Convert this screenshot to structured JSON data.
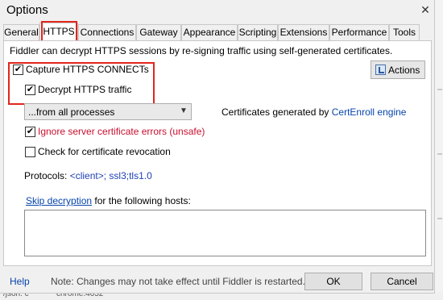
{
  "window": {
    "title": "Options"
  },
  "tabs": [
    {
      "label": "General"
    },
    {
      "label": "HTTPS"
    },
    {
      "label": "Connections"
    },
    {
      "label": "Gateway"
    },
    {
      "label": "Appearance"
    },
    {
      "label": "Scripting"
    },
    {
      "label": "Extensions"
    },
    {
      "label": "Performance"
    },
    {
      "label": "Tools"
    }
  ],
  "active_tab": "HTTPS",
  "https": {
    "intro": "Fiddler can decrypt HTTPS sessions by re-signing traffic using self-generated certificates.",
    "capture": {
      "label": "Capture HTTPS CONNECTs",
      "checked": true
    },
    "decrypt": {
      "label": "Decrypt HTTPS traffic",
      "checked": true
    },
    "process_filter": {
      "selected": "...from all processes"
    },
    "cert_prefix": "Certificates generated by",
    "cert_engine": "CertEnroll engine",
    "ignore_errors": {
      "label": "Ignore server certificate errors (unsafe)",
      "checked": true
    },
    "revocation": {
      "label": "Check for certificate revocation",
      "checked": false
    },
    "protocols_label": "Protocols:",
    "protocols_value": "<client>; ssl3;tls1.0",
    "skip_link": "Skip decryption",
    "skip_suffix": "for the following hosts:",
    "hosts_value": "",
    "actions_label": "Actions"
  },
  "footer": {
    "help": "Help",
    "note": "Note: Changes may not take effect until Fiddler is restarted.",
    "ok": "OK",
    "cancel": "Cancel"
  },
  "background": {
    "left_text": "/json: c",
    "right_text": "chrome:4652"
  },
  "colors": {
    "highlight_red": "#e1261c",
    "link_blue": "#0645ad",
    "warning_red": "#c8102e"
  }
}
